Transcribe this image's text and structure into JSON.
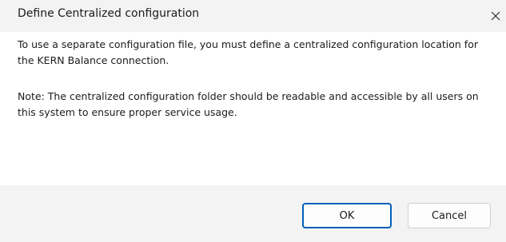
{
  "dialog": {
    "title": "Define Centralized configuration",
    "close_icon": "close-icon",
    "message_line1": "To use a separate configuration file, you must define a centralized configuration location for the KERN Balance connection.",
    "message_line2": "Note: The centralized configuration folder should be readable and accessible by all users on this system to ensure proper service usage."
  },
  "buttons": {
    "ok_label": "OK",
    "cancel_label": "Cancel"
  },
  "colors": {
    "chrome_bg": "#f3f3f3",
    "content_bg": "#ffffff",
    "focus_border": "#005fb8",
    "text": "#1b1b1b"
  }
}
